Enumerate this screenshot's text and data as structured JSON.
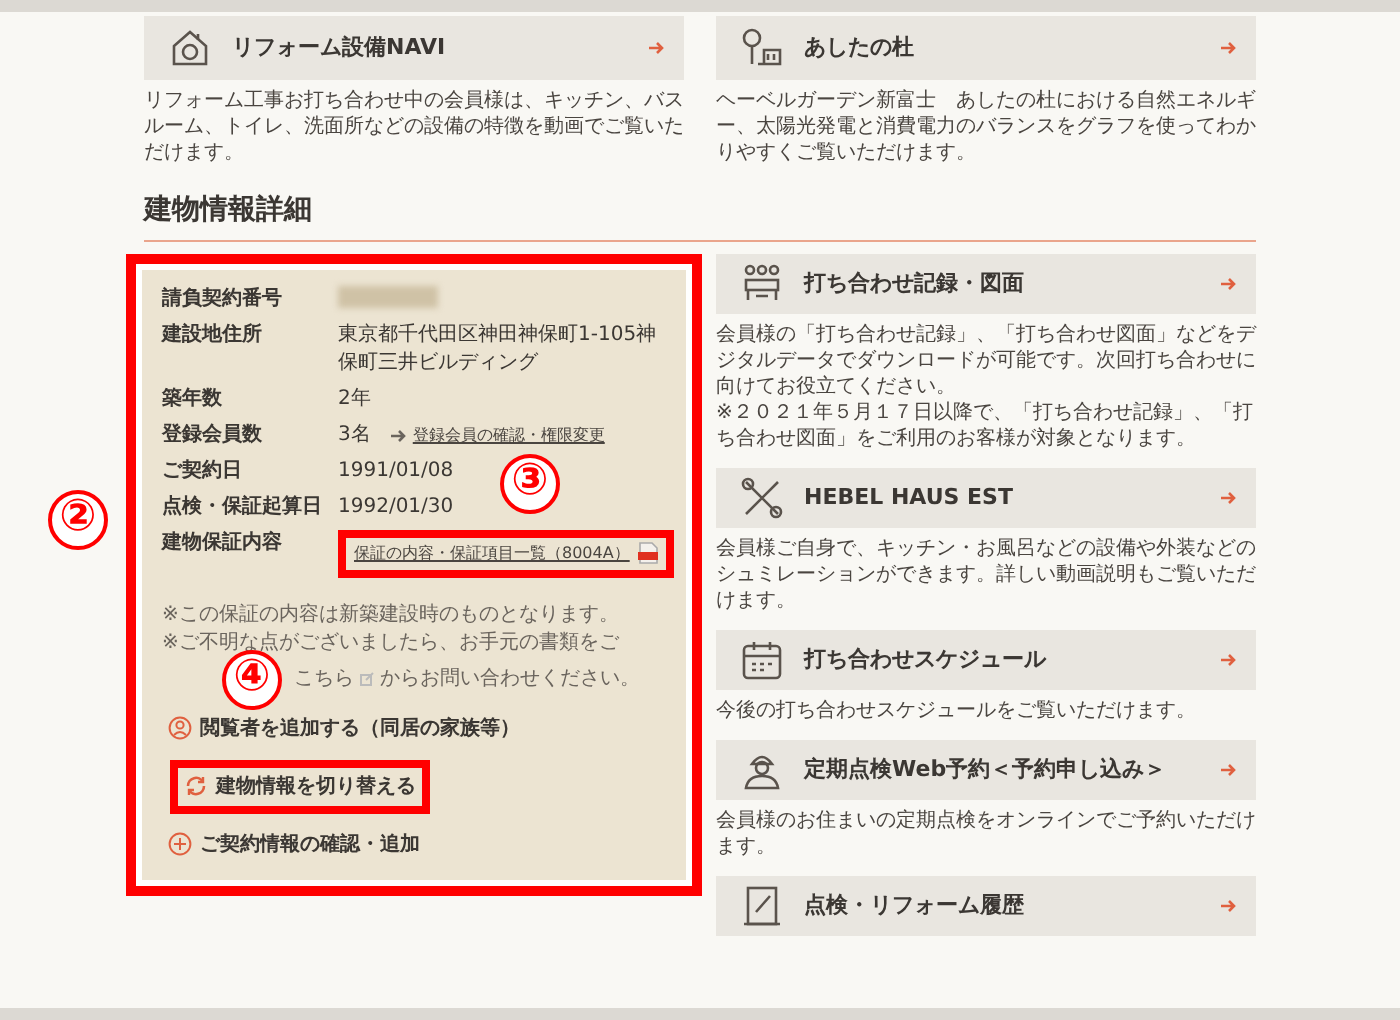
{
  "top_links": [
    {
      "title": "リフォーム設備NAVI",
      "description": [
        "リフォーム工事お打ち合わせ中の会員様は、キッチン、バスルーム、トイレ、洗面所などの設備の特徴を動画でご覧いただけます。"
      ]
    },
    {
      "title": "あしたの杜",
      "description": [
        "ヘーベルガーデン新富士　あしたの杜における自然エネルギー、太陽光発電と消費電力のバランスをグラフを使ってわかりやすくご覧いただけます。"
      ]
    }
  ],
  "section_title": "建物情報詳細",
  "building_info": {
    "rows": [
      {
        "kind": "redacted",
        "label": "請負契約番号",
        "highlighted": false
      },
      {
        "kind": "text",
        "label": "建設地住所",
        "value": "東京都千代田区神田神保町1-105神保町三井ビルディング",
        "highlighted": false
      },
      {
        "kind": "text",
        "label": "築年数",
        "value": "2年",
        "highlighted": false
      },
      {
        "kind": "text_link",
        "label": "登録会員数",
        "value": "3名",
        "link": "登録会員の確認・権限変更",
        "highlighted": false
      },
      {
        "kind": "text",
        "label": "ご契約日",
        "value": "1991/01/08",
        "highlighted": false
      },
      {
        "kind": "text",
        "label": "点検・保証起算日",
        "value": "1992/01/30",
        "highlighted": false
      },
      {
        "kind": "pdf",
        "label": "建物保証内容",
        "value": "保証の内容・保証項目一覧（8004A）",
        "highlighted": true
      }
    ],
    "notes": [
      {
        "text": "※この保証の内容は新築建設時のものとなります。"
      },
      {
        "text": "※ご不明な点がございましたら、お手元の書類をご",
        "link": "こちら",
        "after": "からお問い合わせください。"
      }
    ],
    "actions": [
      {
        "label": "閲覧者を追加する（同居の家族等）",
        "highlighted": false
      },
      {
        "label": "建物情報を切り替える",
        "highlighted": true
      },
      {
        "label": "ご契約情報の確認・追加",
        "highlighted": false
      }
    ]
  },
  "services": [
    {
      "title": "打ち合わせ記録・図面",
      "description": [
        "会員様の「打ち合わせ記録」、「打ち合わせ図面」などをデジタルデータでダウンロードが可能です。次回打ち合わせに向けてお役立てください。",
        "※２０２１年５月１７日以降で、「打ち合わせ記録」、「打ち合わせ図面」をご利用のお客様が対象となります。"
      ]
    },
    {
      "title": "HEBEL HAUS EST",
      "description": [
        "会員様ご自身で、キッチン・お風呂などの設備や外装などのシュミレーションができます。詳しい動画説明もご覧いただけます。"
      ]
    },
    {
      "title": "打ち合わせスケジュール",
      "description": [
        "今後の打ち合わせスケジュールをご覧いただけます。"
      ]
    },
    {
      "title": "定期点検Web予約＜予約申し込み＞",
      "description": [
        "会員様のお住まいの定期点検をオンラインでご予約いただけます。"
      ]
    },
    {
      "title": "点検・リフォーム履歴"
    }
  ],
  "annotations": [
    {
      "number": "②"
    },
    {
      "number": "③"
    },
    {
      "number": "④"
    }
  ]
}
